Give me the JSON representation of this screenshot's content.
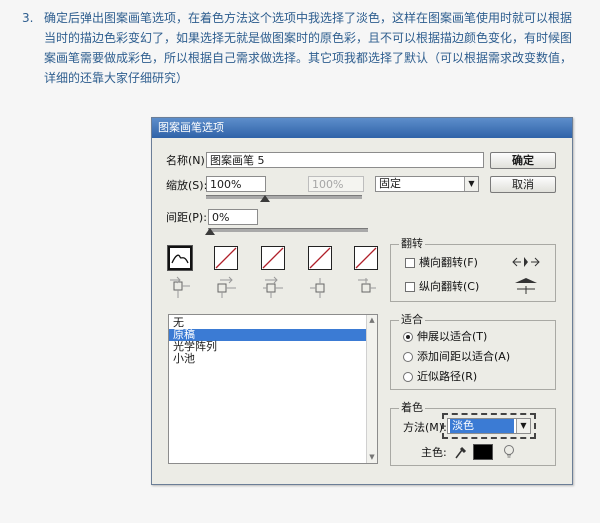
{
  "tutorial": {
    "step_number": "3.",
    "text": "确定后弹出图案画笔选项，在着色方法这个选项中我选择了淡色，这样在图案画笔使用时就可以根据当时的描边色彩变幻了，如果选择无就是做图案时的原色彩，且不可以根据描边颜色变化，有时候图案画笔需要做成彩色，所以根据自己需求做选择。其它项我都选择了默认（可以根据需求改变数值，详细的还靠大家仔细研究）"
  },
  "dialog": {
    "title": "图案画笔选项",
    "name_label": "名称(N):",
    "name_value": "图案画笔 5",
    "ok_label": "确定",
    "cancel_label": "取消",
    "scale_label": "缩放(S):",
    "scale_value": "100%",
    "scale_value_disabled": "100%",
    "scale_mode": "固定",
    "spacing_label": "间距(P):",
    "spacing_value": "0%",
    "flip": {
      "title": "翻转",
      "horizontal_label": "横向翻转(F)",
      "vertical_label": "纵向翻转(C)"
    },
    "fit": {
      "title": "适合",
      "options": [
        "伸展以适合(T)",
        "添加间距以适合(A)",
        "近似路径(R)"
      ],
      "selected": 0
    },
    "tile_list": {
      "items": [
        "无",
        "原稿",
        "光学阵列",
        "小池"
      ],
      "selected": 1
    },
    "colorization": {
      "title": "着色",
      "method_label": "方法(M):",
      "method_value": "淡色",
      "key_color_label": "主色:",
      "key_color": "#000000"
    },
    "colors": {
      "titlebar_top": "#5d8ecb",
      "titlebar_bottom": "#2f62a8",
      "selection": "#3b7bd4",
      "tile_slash": "#b0202a"
    }
  }
}
